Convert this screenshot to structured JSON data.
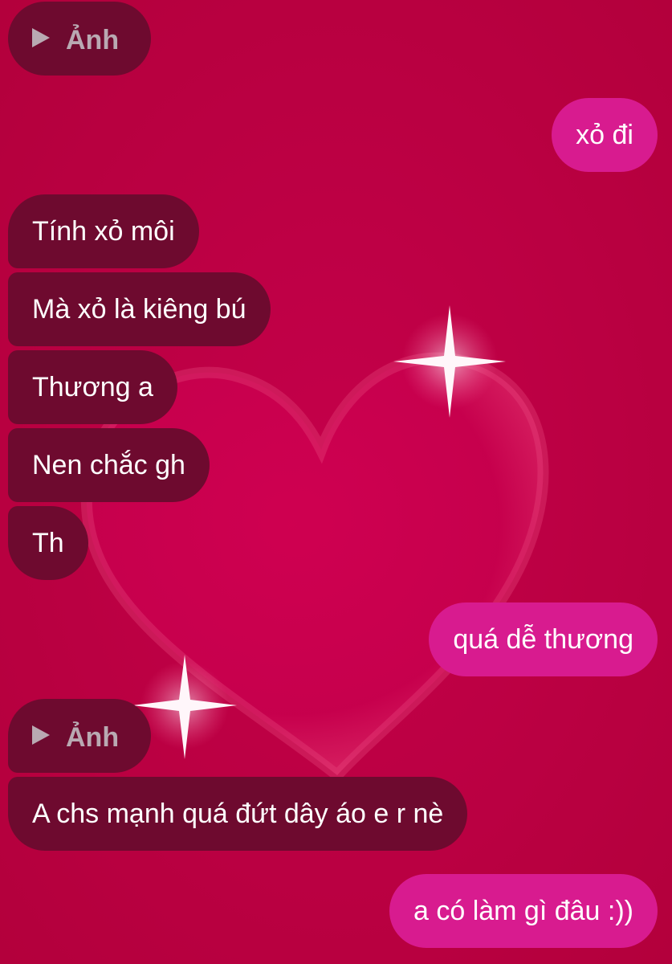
{
  "theme": {
    "background": "#b8003f",
    "received_bubble": "#6e0a2f",
    "sent_bubble": "#d81b8f",
    "media_text": "#b9a9b2",
    "decoration": "heart-with-sparkles"
  },
  "messages": [
    {
      "side": "received",
      "kind": "media",
      "icon": "play-icon",
      "text": "Ảnh"
    },
    {
      "side": "sent",
      "kind": "text",
      "text": "xỏ đi"
    },
    {
      "side": "received",
      "kind": "text",
      "text": "Tính xỏ môi"
    },
    {
      "side": "received",
      "kind": "text",
      "text": "Mà xỏ là kiêng bú"
    },
    {
      "side": "received",
      "kind": "text",
      "text": "Thương a"
    },
    {
      "side": "received",
      "kind": "text",
      "text": "Nen chắc gh"
    },
    {
      "side": "received",
      "kind": "text",
      "text": "Th"
    },
    {
      "side": "sent",
      "kind": "text",
      "text": "quá dễ thương"
    },
    {
      "side": "received",
      "kind": "media",
      "icon": "play-icon",
      "text": "Ảnh"
    },
    {
      "side": "received",
      "kind": "text",
      "text": "A chs mạnh quá đứt dây áo e r nè"
    },
    {
      "side": "sent",
      "kind": "text",
      "text": "a có làm gì đâu :))"
    }
  ]
}
